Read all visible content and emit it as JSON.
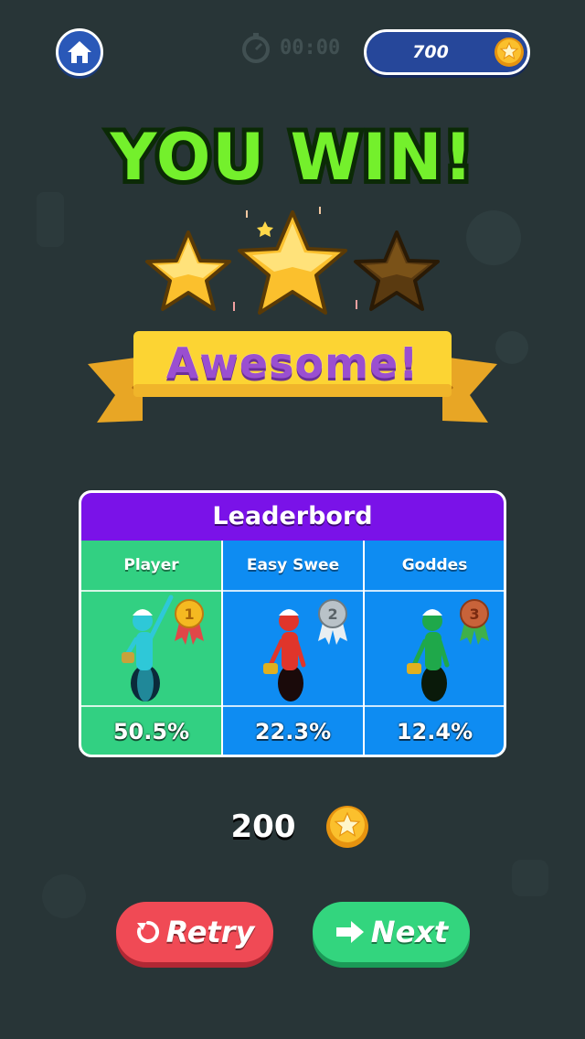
{
  "header": {
    "home_icon": "home-icon",
    "timer_text": "00:00",
    "coins": "700"
  },
  "result": {
    "title": "YOU WIN!",
    "stars_earned": 2,
    "stars_total": 3,
    "rating_label": "Awesome!"
  },
  "leaderboard": {
    "title": "Leaderbord",
    "entries": [
      {
        "name": "Player",
        "medal": "gold-medal-1",
        "color": "#32d082",
        "figure_color": "#2ec8d8",
        "score": "50.5%"
      },
      {
        "name": "Easy Swee",
        "medal": "silver-medal-2",
        "color": "#0e8cf2",
        "figure_color": "#e0352b",
        "score": "22.3%"
      },
      {
        "name": "Goddes",
        "medal": "bronze-medal-3",
        "color": "#0e8cf2",
        "figure_color": "#1fa84a",
        "score": "12.4%"
      }
    ]
  },
  "reward": {
    "value": "200",
    "icon": "coin-icon"
  },
  "buttons": {
    "retry_label": "Retry",
    "next_label": "Next"
  },
  "colors": {
    "title_green": "#74f02c",
    "ribbon_yellow": "#fcd433",
    "rating_purple": "#9a4fd0",
    "header_purple": "#7a12e8"
  }
}
